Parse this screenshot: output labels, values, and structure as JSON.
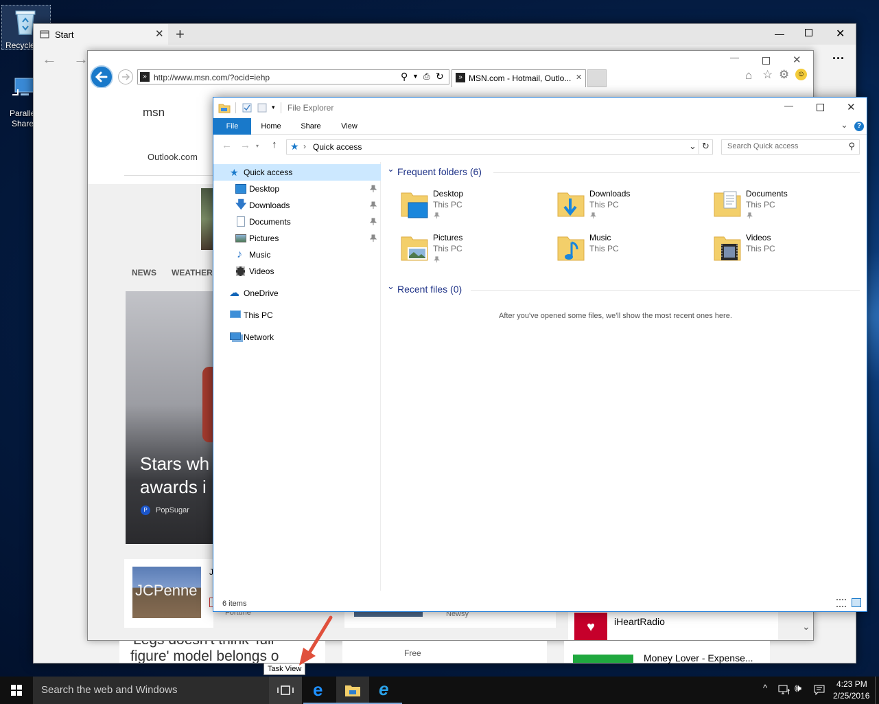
{
  "desktop": {
    "icons": [
      {
        "label": "Recycle"
      },
      {
        "label": "Paralle"
      },
      {
        "label": "Share"
      }
    ]
  },
  "edge": {
    "tab_title": "Start",
    "new_tab": "+",
    "more": "···"
  },
  "ie": {
    "url": "http://www.msn.com/?ocid=iehp",
    "tab_title": "MSN.com - Hotmail, Outlo...",
    "page": {
      "logo": "msn",
      "outlook": "Outlook.com",
      "nav": [
        "NEWS",
        "WEATHER"
      ],
      "hero_line1": "Stars wh",
      "hero_line2": "awards i",
      "hero_source": "PopSugar",
      "jcp_text": "JCPenne",
      "story_letter": "J",
      "source_fortune": "Fortune",
      "source_newsy": "Newsy",
      "free_label": "Free",
      "iheart": "iHeartRadio",
      "money": "Money Lover - Expense...",
      "headline1": "'Legs doesn't think 'full-",
      "headline2": "figure' model belongs o"
    }
  },
  "explorer": {
    "title": "File Explorer",
    "ribbon_tabs": [
      "File",
      "Home",
      "Share",
      "View"
    ],
    "address": "Quick access",
    "search_placeholder": "Search Quick access",
    "nav": {
      "quick_access": "Quick access",
      "desktop": "Desktop",
      "downloads": "Downloads",
      "documents": "Documents",
      "pictures": "Pictures",
      "music": "Music",
      "videos": "Videos",
      "onedrive": "OneDrive",
      "thispc": "This PC",
      "network": "Network"
    },
    "frequent_header": "Frequent folders (6)",
    "recent_header": "Recent files (0)",
    "recent_empty": "After you've opened some files, we'll show the most recent ones here.",
    "folders": [
      {
        "name": "Desktop",
        "loc": "This PC"
      },
      {
        "name": "Downloads",
        "loc": "This PC"
      },
      {
        "name": "Documents",
        "loc": "This PC"
      },
      {
        "name": "Pictures",
        "loc": "This PC"
      },
      {
        "name": "Music",
        "loc": "This PC"
      },
      {
        "name": "Videos",
        "loc": "This PC"
      }
    ],
    "status": "6 items"
  },
  "tooltip": "Task View",
  "taskbar": {
    "search_placeholder": "Search the web and Windows",
    "time": "4:23 PM",
    "date": "2/25/2016"
  },
  "colors": {
    "accent": "#1979ca",
    "arrow": "#e0503c",
    "folder_yellow": "#f3cf6a"
  }
}
